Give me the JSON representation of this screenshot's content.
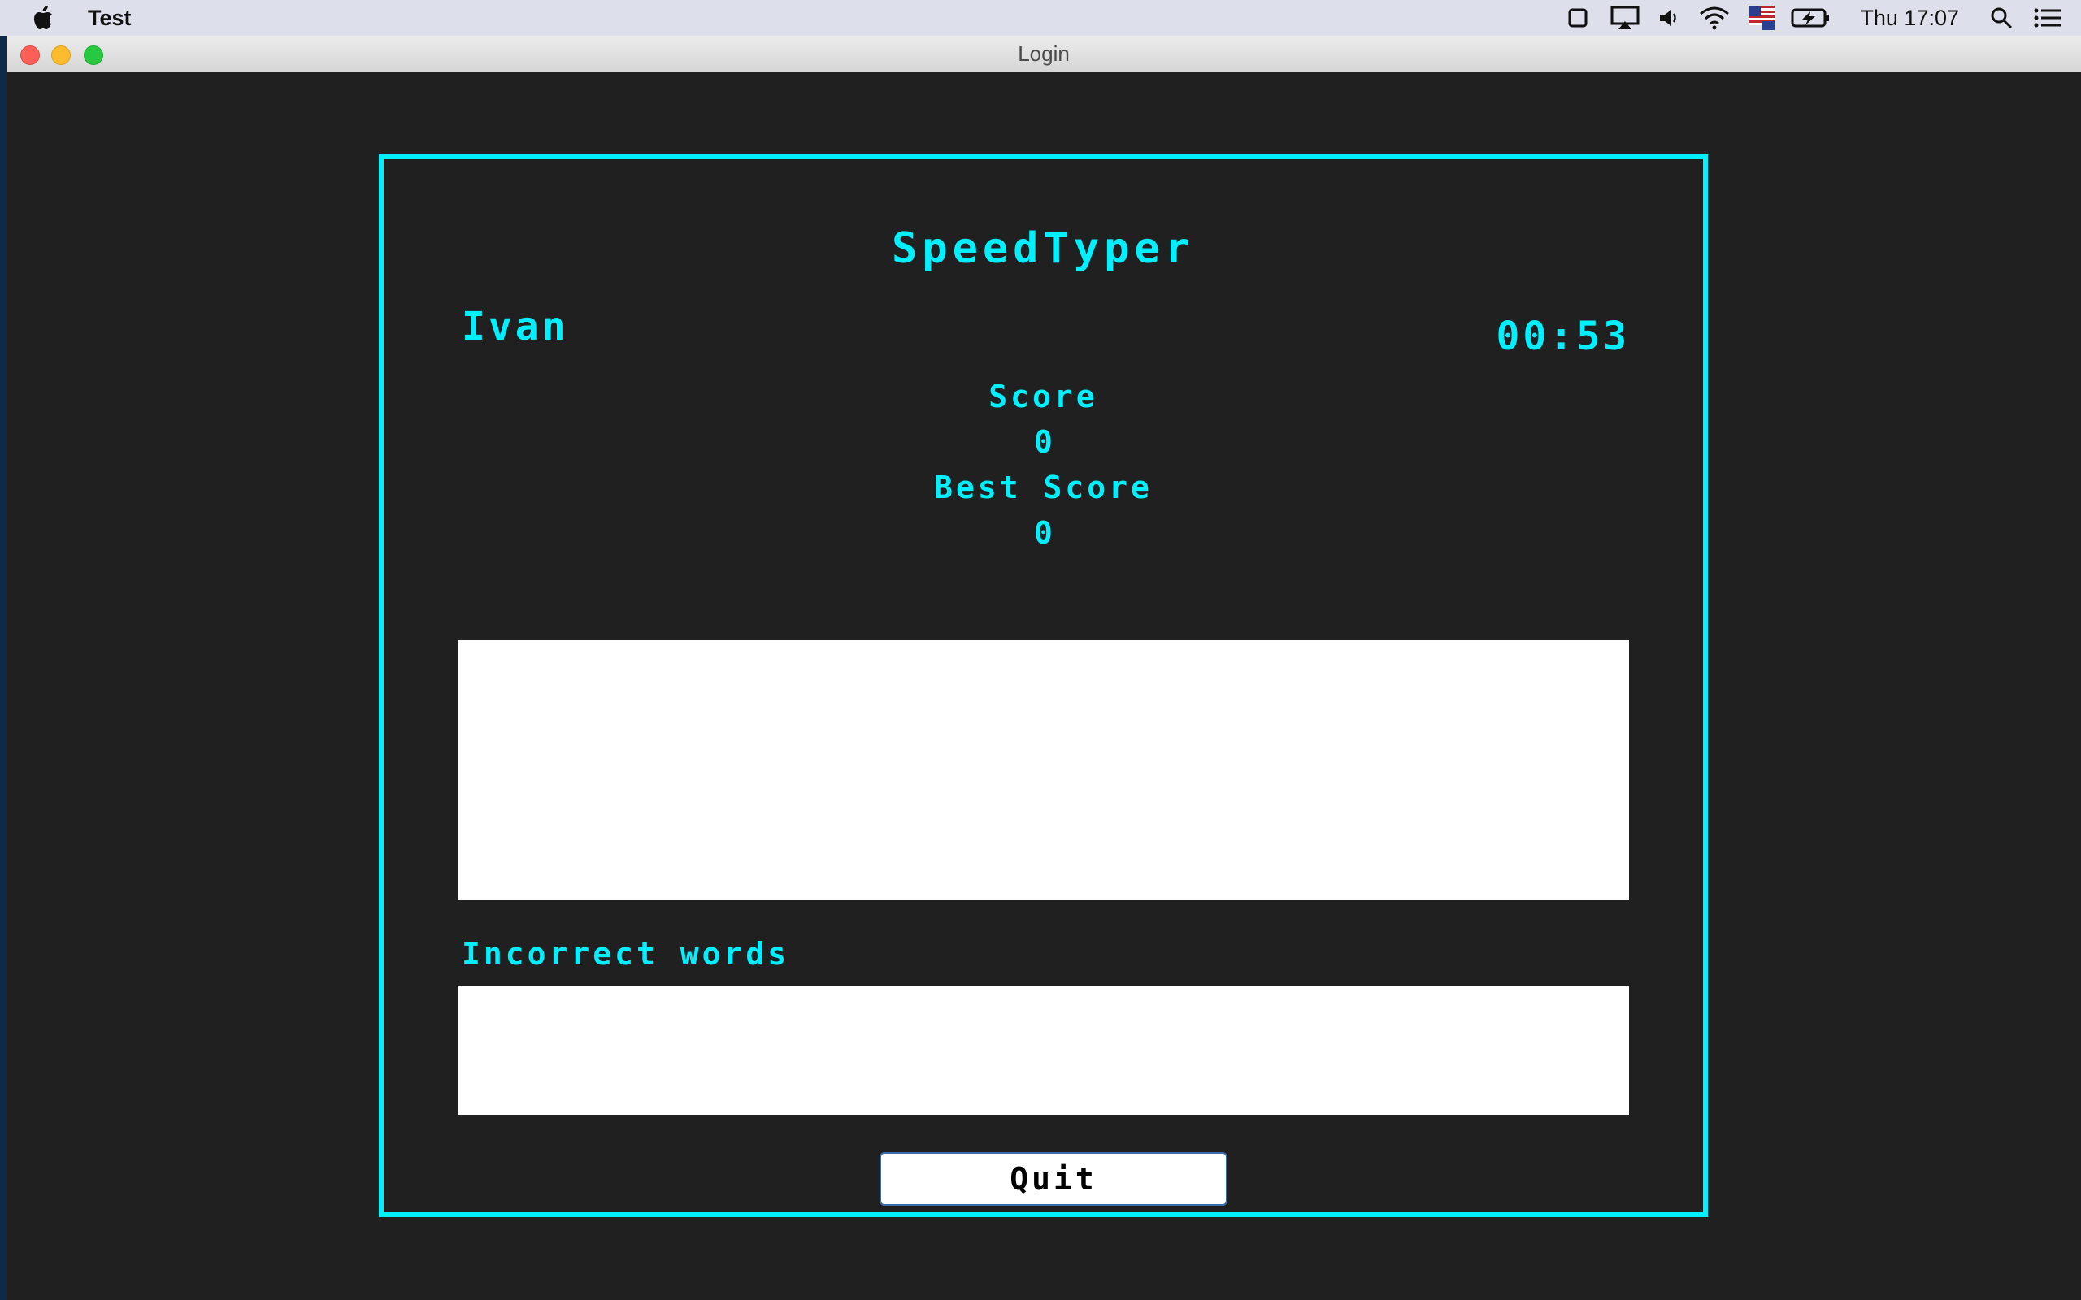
{
  "menubar": {
    "app_name": "Test",
    "clock": "Thu 17:07",
    "icons": [
      "apple-icon",
      "screen-mirror-icon",
      "airplay-icon",
      "volume-icon",
      "wifi-icon",
      "input-flag-icon",
      "battery-icon",
      "spotlight-search-icon",
      "notification-center-icon"
    ]
  },
  "window": {
    "title": "Login"
  },
  "game": {
    "title": "SpeedTyper",
    "player_name": "Ivan",
    "timer": "00:53",
    "score_label": "Score",
    "score_value": "0",
    "best_score_label": "Best Score",
    "best_score_value": "0",
    "typing_text": "",
    "incorrect_label": "Incorrect words",
    "incorrect_words": "",
    "quit_label": "Quit"
  },
  "colors": {
    "accent": "#00f0ff",
    "background": "#202020"
  }
}
